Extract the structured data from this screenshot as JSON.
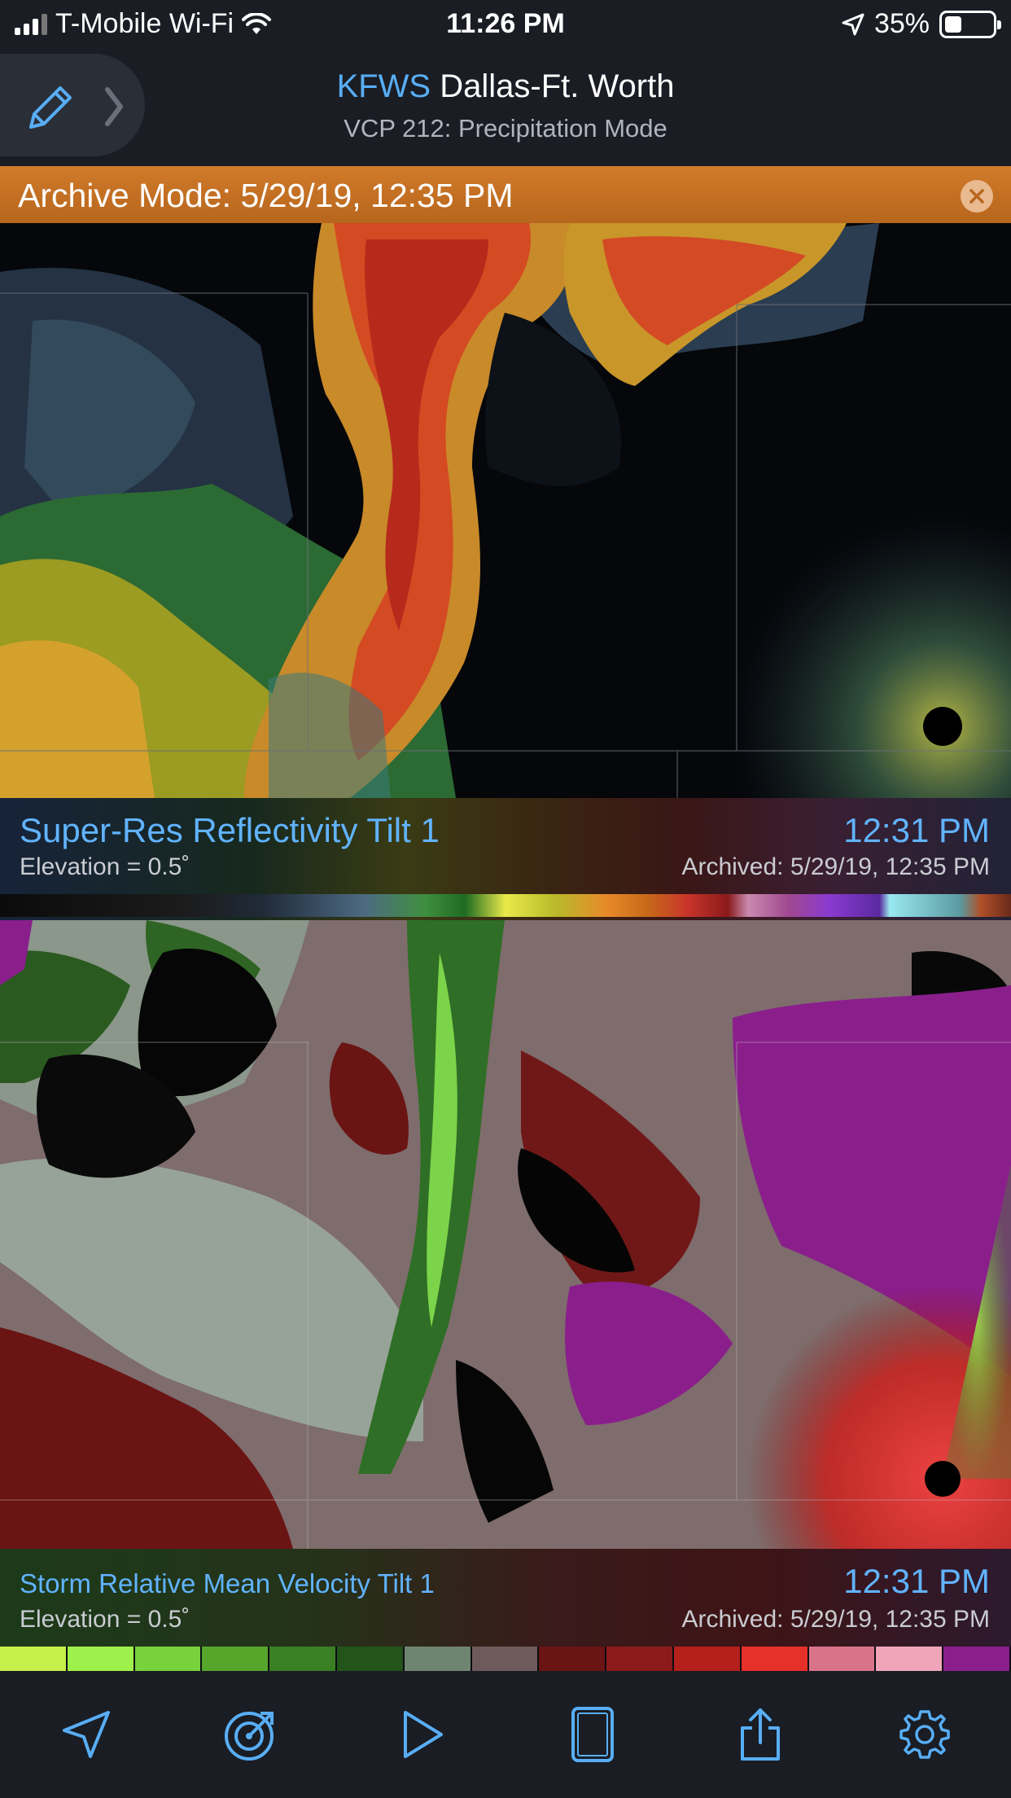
{
  "status_bar": {
    "carrier": "T-Mobile Wi-Fi",
    "time": "11:26 PM",
    "battery": "35%",
    "battery_level": 0.35,
    "icons": [
      "cellular-signal-icon",
      "wifi-icon",
      "location-arrow-icon",
      "battery-icon"
    ]
  },
  "header": {
    "site_code": "KFWS",
    "site_name": "Dallas-Ft. Worth",
    "mode": "VCP 212: Precipitation Mode",
    "icons": [
      "pencil-icon",
      "chevron-right-icon"
    ]
  },
  "archive_bar": {
    "label": "Archive Mode: 5/29/19, 12:35 PM",
    "color": "#c8702a",
    "close_icon": "close-circle-icon"
  },
  "panels": [
    {
      "product": "Super-Res Reflectivity Tilt 1",
      "elevation": "Elevation = 0.5˚",
      "time": "12:31 PM",
      "archived": "Archived: 5/29/19, 12:35 PM"
    },
    {
      "product": "Storm Relative Mean Velocity Tilt 1",
      "elevation": "Elevation = 0.5˚",
      "time": "12:31 PM",
      "archived": "Archived: 5/29/19, 12:35 PM",
      "scale_colors": [
        "#c6f04a",
        "#9ef04a",
        "#78d23c",
        "#56a62c",
        "#3a7f23",
        "#23541a",
        "#6f8570",
        "#6e5a5a",
        "#6a1414",
        "#8c1a1a",
        "#b4201c",
        "#e6302a",
        "#d8748a",
        "#f0a6b8",
        "#8a1f8c"
      ]
    }
  ],
  "accent_color": "#58aef5",
  "tab_bar": {
    "icons": [
      "location-arrow-icon",
      "radar-sweep-icon",
      "play-icon",
      "split-view-icon",
      "share-icon",
      "gear-icon"
    ]
  }
}
